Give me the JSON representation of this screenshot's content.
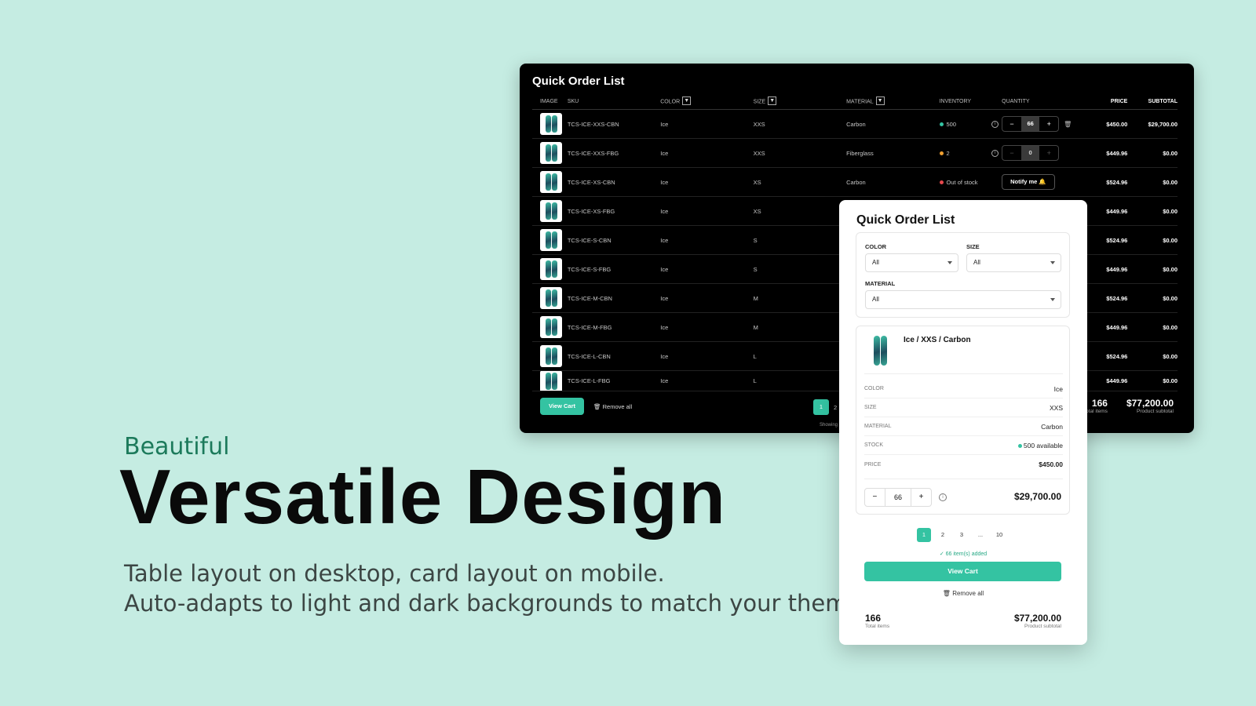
{
  "marketing": {
    "eyebrow": "Beautiful",
    "headline": "Versatile Design",
    "line1": "Table layout on desktop, card layout on mobile.",
    "line2": "Auto-adapts to light and dark backgrounds to match your theme."
  },
  "desktop": {
    "title": "Quick Order List",
    "headers": {
      "image": "IMAGE",
      "sku": "SKU",
      "color": "COLOR",
      "size": "SIZE",
      "material": "MATERIAL",
      "inventory": "INVENTORY",
      "quantity": "QUANTITY",
      "price": "PRICE",
      "subtotal": "SUBTOTAL"
    },
    "rows": [
      {
        "sku": "TCS-ICE-XXS-CBN",
        "color": "Ice",
        "size": "XXS",
        "material": "Carbon",
        "inventory": "500",
        "qty": "66",
        "price": "$450.00",
        "subtotal": "$29,700.00"
      },
      {
        "sku": "TCS-ICE-XXS-FBG",
        "color": "Ice",
        "size": "XXS",
        "material": "Fiberglass",
        "inventory": "2",
        "qty": "0",
        "price": "$449.96",
        "subtotal": "$0.00"
      },
      {
        "sku": "TCS-ICE-XS-CBN",
        "color": "Ice",
        "size": "XS",
        "material": "Carbon",
        "inventory": "Out of stock",
        "action": "Notify me",
        "price": "$524.96",
        "subtotal": "$0.00"
      },
      {
        "sku": "TCS-ICE-XS-FBG",
        "color": "Ice",
        "size": "XS",
        "price": "$449.96",
        "subtotal": "$0.00"
      },
      {
        "sku": "TCS-ICE-S-CBN",
        "color": "Ice",
        "size": "S",
        "price": "$524.96",
        "subtotal": "$0.00"
      },
      {
        "sku": "TCS-ICE-S-FBG",
        "color": "Ice",
        "size": "S",
        "price": "$449.96",
        "subtotal": "$0.00"
      },
      {
        "sku": "TCS-ICE-M-CBN",
        "color": "Ice",
        "size": "M",
        "price": "$524.96",
        "subtotal": "$0.00"
      },
      {
        "sku": "TCS-ICE-M-FBG",
        "color": "Ice",
        "size": "M",
        "price": "$449.96",
        "subtotal": "$0.00"
      },
      {
        "sku": "TCS-ICE-L-CBN",
        "color": "Ice",
        "size": "L",
        "price": "$524.96",
        "subtotal": "$0.00"
      },
      {
        "sku": "TCS-ICE-L-FBG",
        "color": "Ice",
        "size": "L",
        "price": "$449.96",
        "subtotal": "$0.00"
      }
    ],
    "view_cart": "View Cart",
    "remove_all": "Remove all",
    "page_current": "1",
    "page_next": "2",
    "showing": "Showing",
    "total_items": "166",
    "total_items_label": "Total items",
    "subtotal": "$77,200.00",
    "subtotal_label": "Product subtotal",
    "colors": {
      "accent": "#34c3a2",
      "in_stock": "#34c3a2",
      "low_stock": "#f0a030",
      "out_of_stock": "#e5484d"
    }
  },
  "mobile": {
    "title": "Quick Order List",
    "filters": {
      "color_label": "COLOR",
      "color_value": "All",
      "size_label": "SIZE",
      "size_value": "All",
      "material_label": "MATERIAL",
      "material_value": "All"
    },
    "item": {
      "name": "Ice / XXS / Carbon",
      "color_label": "COLOR",
      "color": "Ice",
      "size_label": "SIZE",
      "size": "XXS",
      "material_label": "MATERIAL",
      "material": "Carbon",
      "stock_label": "STOCK",
      "stock": "500 available",
      "price_label": "PRICE",
      "price": "$450.00",
      "qty": "66",
      "line_total": "$29,700.00"
    },
    "pages": [
      "1",
      "2",
      "3",
      "...",
      "10"
    ],
    "added": "66 item(s) added",
    "view_cart": "View Cart",
    "remove_all": "Remove all",
    "total_items": "166",
    "total_items_label": "Total items",
    "subtotal": "$77,200.00",
    "subtotal_label": "Product subtotal"
  }
}
